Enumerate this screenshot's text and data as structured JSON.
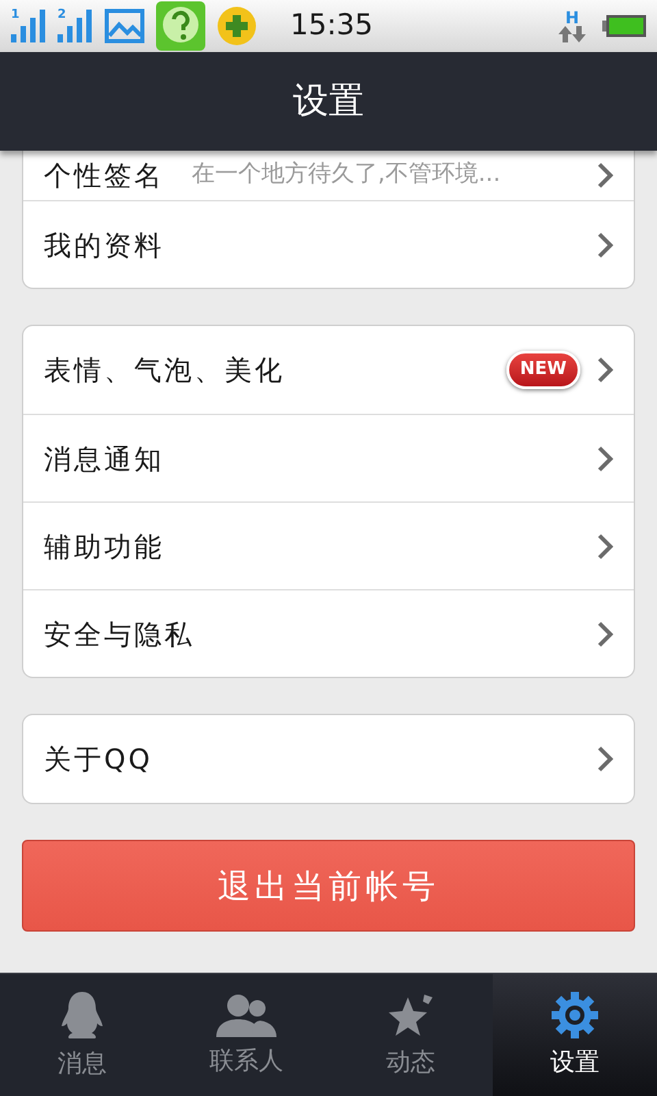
{
  "status_bar": {
    "time": "15:35",
    "data_label": "H",
    "sim_labels": [
      "1",
      "2"
    ]
  },
  "header": {
    "title": "设置"
  },
  "groups": [
    {
      "rows": [
        {
          "label": "个性签名",
          "value": "在一个地方待久了,不管环境..."
        },
        {
          "label": "我的资料"
        }
      ]
    },
    {
      "rows": [
        {
          "label": "表情、气泡、美化",
          "badge": "NEW"
        },
        {
          "label": "消息通知"
        },
        {
          "label": "辅助功能"
        },
        {
          "label": "安全与隐私"
        }
      ]
    },
    {
      "rows": [
        {
          "label": "关于QQ"
        }
      ]
    }
  ],
  "logout_button": "退出当前帐号",
  "tabs": [
    {
      "label": "消息",
      "kind": "penguin",
      "selected": false
    },
    {
      "label": "联系人",
      "kind": "contacts",
      "selected": false
    },
    {
      "label": "动态",
      "kind": "star",
      "selected": false
    },
    {
      "label": "设置",
      "kind": "gear",
      "selected": true
    }
  ]
}
